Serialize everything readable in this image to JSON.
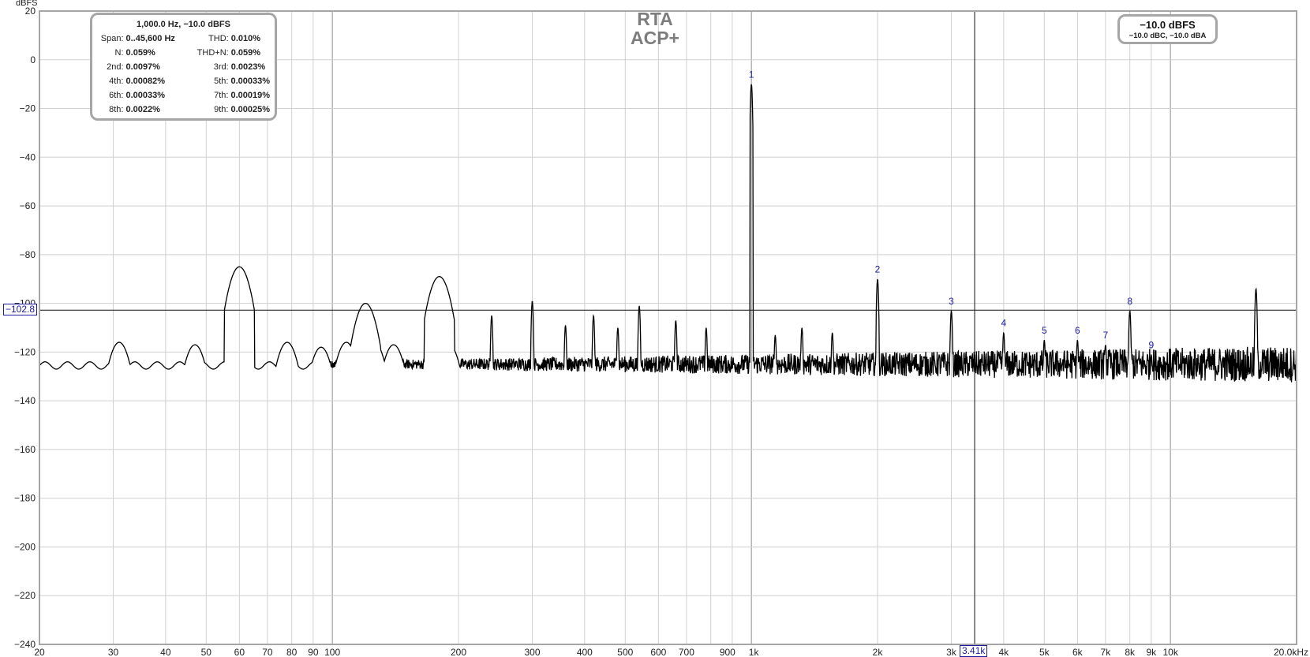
{
  "unit_label": "dBFS",
  "rta_title": [
    "RTA",
    "ACP+"
  ],
  "stats_box": {
    "header": "1,000.0 Hz, −10.0 dBFS",
    "rows": [
      {
        "l1": "Span:",
        "v1": "0..45,600 Hz",
        "l2": "THD:",
        "v2": "0.010%"
      },
      {
        "l1": "N:",
        "v1": "0.059%",
        "l2": "THD+N:",
        "v2": "0.059%"
      },
      {
        "l1": "2nd:",
        "v1": "0.0097%",
        "l2": "3rd:",
        "v2": "0.0023%"
      },
      {
        "l1": "4th:",
        "v1": "0.00082%",
        "l2": "5th:",
        "v2": "0.00033%"
      },
      {
        "l1": "6th:",
        "v1": "0.00033%",
        "l2": "7th:",
        "v2": "0.00019%"
      },
      {
        "l1": "8th:",
        "v1": "0.0022%",
        "l2": "9th:",
        "v2": "0.00025%"
      }
    ]
  },
  "level_box": {
    "main": "−10.0 dBFS",
    "sub": "−10.0 dBC, −10.0 dBA"
  },
  "cursor": {
    "x_label": "3.41k",
    "y_label": "−102.8",
    "x_hz": 3410,
    "y_db": -102.8
  },
  "colors": {
    "trace": "#000000",
    "grid_major": "#bdbdbd",
    "grid_minor": "#d8d8d8",
    "marker": "#1a1aa0",
    "frame": "#a6a6a6"
  },
  "chart_data": {
    "type": "line",
    "x_scale": "log",
    "xlim": [
      20,
      20000
    ],
    "ylim": [
      -240,
      20
    ],
    "y_ticks": [
      20,
      0,
      -20,
      -40,
      -60,
      -80,
      -100,
      -120,
      -140,
      -160,
      -180,
      -200,
      -220,
      -240
    ],
    "y_tick_labels": [
      "20",
      "0",
      "−20",
      "−40",
      "−60",
      "−80",
      "−100",
      "−120",
      "−140",
      "−160",
      "−180",
      "−200",
      "−220",
      "−240"
    ],
    "x_ticks": [
      20,
      30,
      40,
      50,
      60,
      70,
      80,
      90,
      100,
      200,
      300,
      400,
      500,
      600,
      700,
      900,
      1000,
      2000,
      3000,
      4000,
      5000,
      6000,
      7000,
      8000,
      9000,
      10000,
      20000
    ],
    "x_tick_labels": [
      "20",
      "30",
      "40",
      "50",
      "60",
      "70",
      "80",
      "90",
      "100",
      "200",
      "300",
      "400",
      "500",
      "600",
      "700",
      "900",
      "1k",
      "2k",
      "3k",
      "4k",
      "5k",
      "6k",
      "7k",
      "8k",
      "9k",
      "10k",
      "20.0kHz"
    ],
    "noise_floor_db": -125,
    "peaks": [
      {
        "hz": 31,
        "db": -116
      },
      {
        "hz": 47,
        "db": -117
      },
      {
        "hz": 60,
        "db": -85
      },
      {
        "hz": 78,
        "db": -116
      },
      {
        "hz": 94,
        "db": -118
      },
      {
        "hz": 108,
        "db": -116
      },
      {
        "hz": 120,
        "db": -100
      },
      {
        "hz": 126,
        "db": -116
      },
      {
        "hz": 140,
        "db": -117
      },
      {
        "hz": 180,
        "db": -89
      },
      {
        "hz": 190,
        "db": -117
      },
      {
        "hz": 240,
        "db": -105
      },
      {
        "hz": 300,
        "db": -99
      },
      {
        "hz": 360,
        "db": -109
      },
      {
        "hz": 420,
        "db": -105
      },
      {
        "hz": 480,
        "db": -110
      },
      {
        "hz": 540,
        "db": -101
      },
      {
        "hz": 660,
        "db": -107
      },
      {
        "hz": 780,
        "db": -110
      },
      {
        "hz": 1000,
        "db": -10
      },
      {
        "hz": 1140,
        "db": -113
      },
      {
        "hz": 1320,
        "db": -110
      },
      {
        "hz": 1560,
        "db": -112
      },
      {
        "hz": 2000,
        "db": -90
      },
      {
        "hz": 3000,
        "db": -103
      },
      {
        "hz": 4000,
        "db": -112
      },
      {
        "hz": 5000,
        "db": -115
      },
      {
        "hz": 6000,
        "db": -115
      },
      {
        "hz": 7000,
        "db": -117
      },
      {
        "hz": 8000,
        "db": -103
      },
      {
        "hz": 9000,
        "db": -121
      },
      {
        "hz": 16000,
        "db": -94
      }
    ],
    "harmonic_markers": [
      {
        "label": "1",
        "hz": 1000,
        "db": -10
      },
      {
        "label": "2",
        "hz": 2000,
        "db": -90
      },
      {
        "label": "3",
        "hz": 3000,
        "db": -103
      },
      {
        "label": "4",
        "hz": 4000,
        "db": -112
      },
      {
        "label": "5",
        "hz": 5000,
        "db": -115
      },
      {
        "label": "6",
        "hz": 6000,
        "db": -115
      },
      {
        "label": "7",
        "hz": 7000,
        "db": -117
      },
      {
        "label": "8",
        "hz": 8000,
        "db": -103
      },
      {
        "label": "9",
        "hz": 9000,
        "db": -121
      }
    ]
  }
}
